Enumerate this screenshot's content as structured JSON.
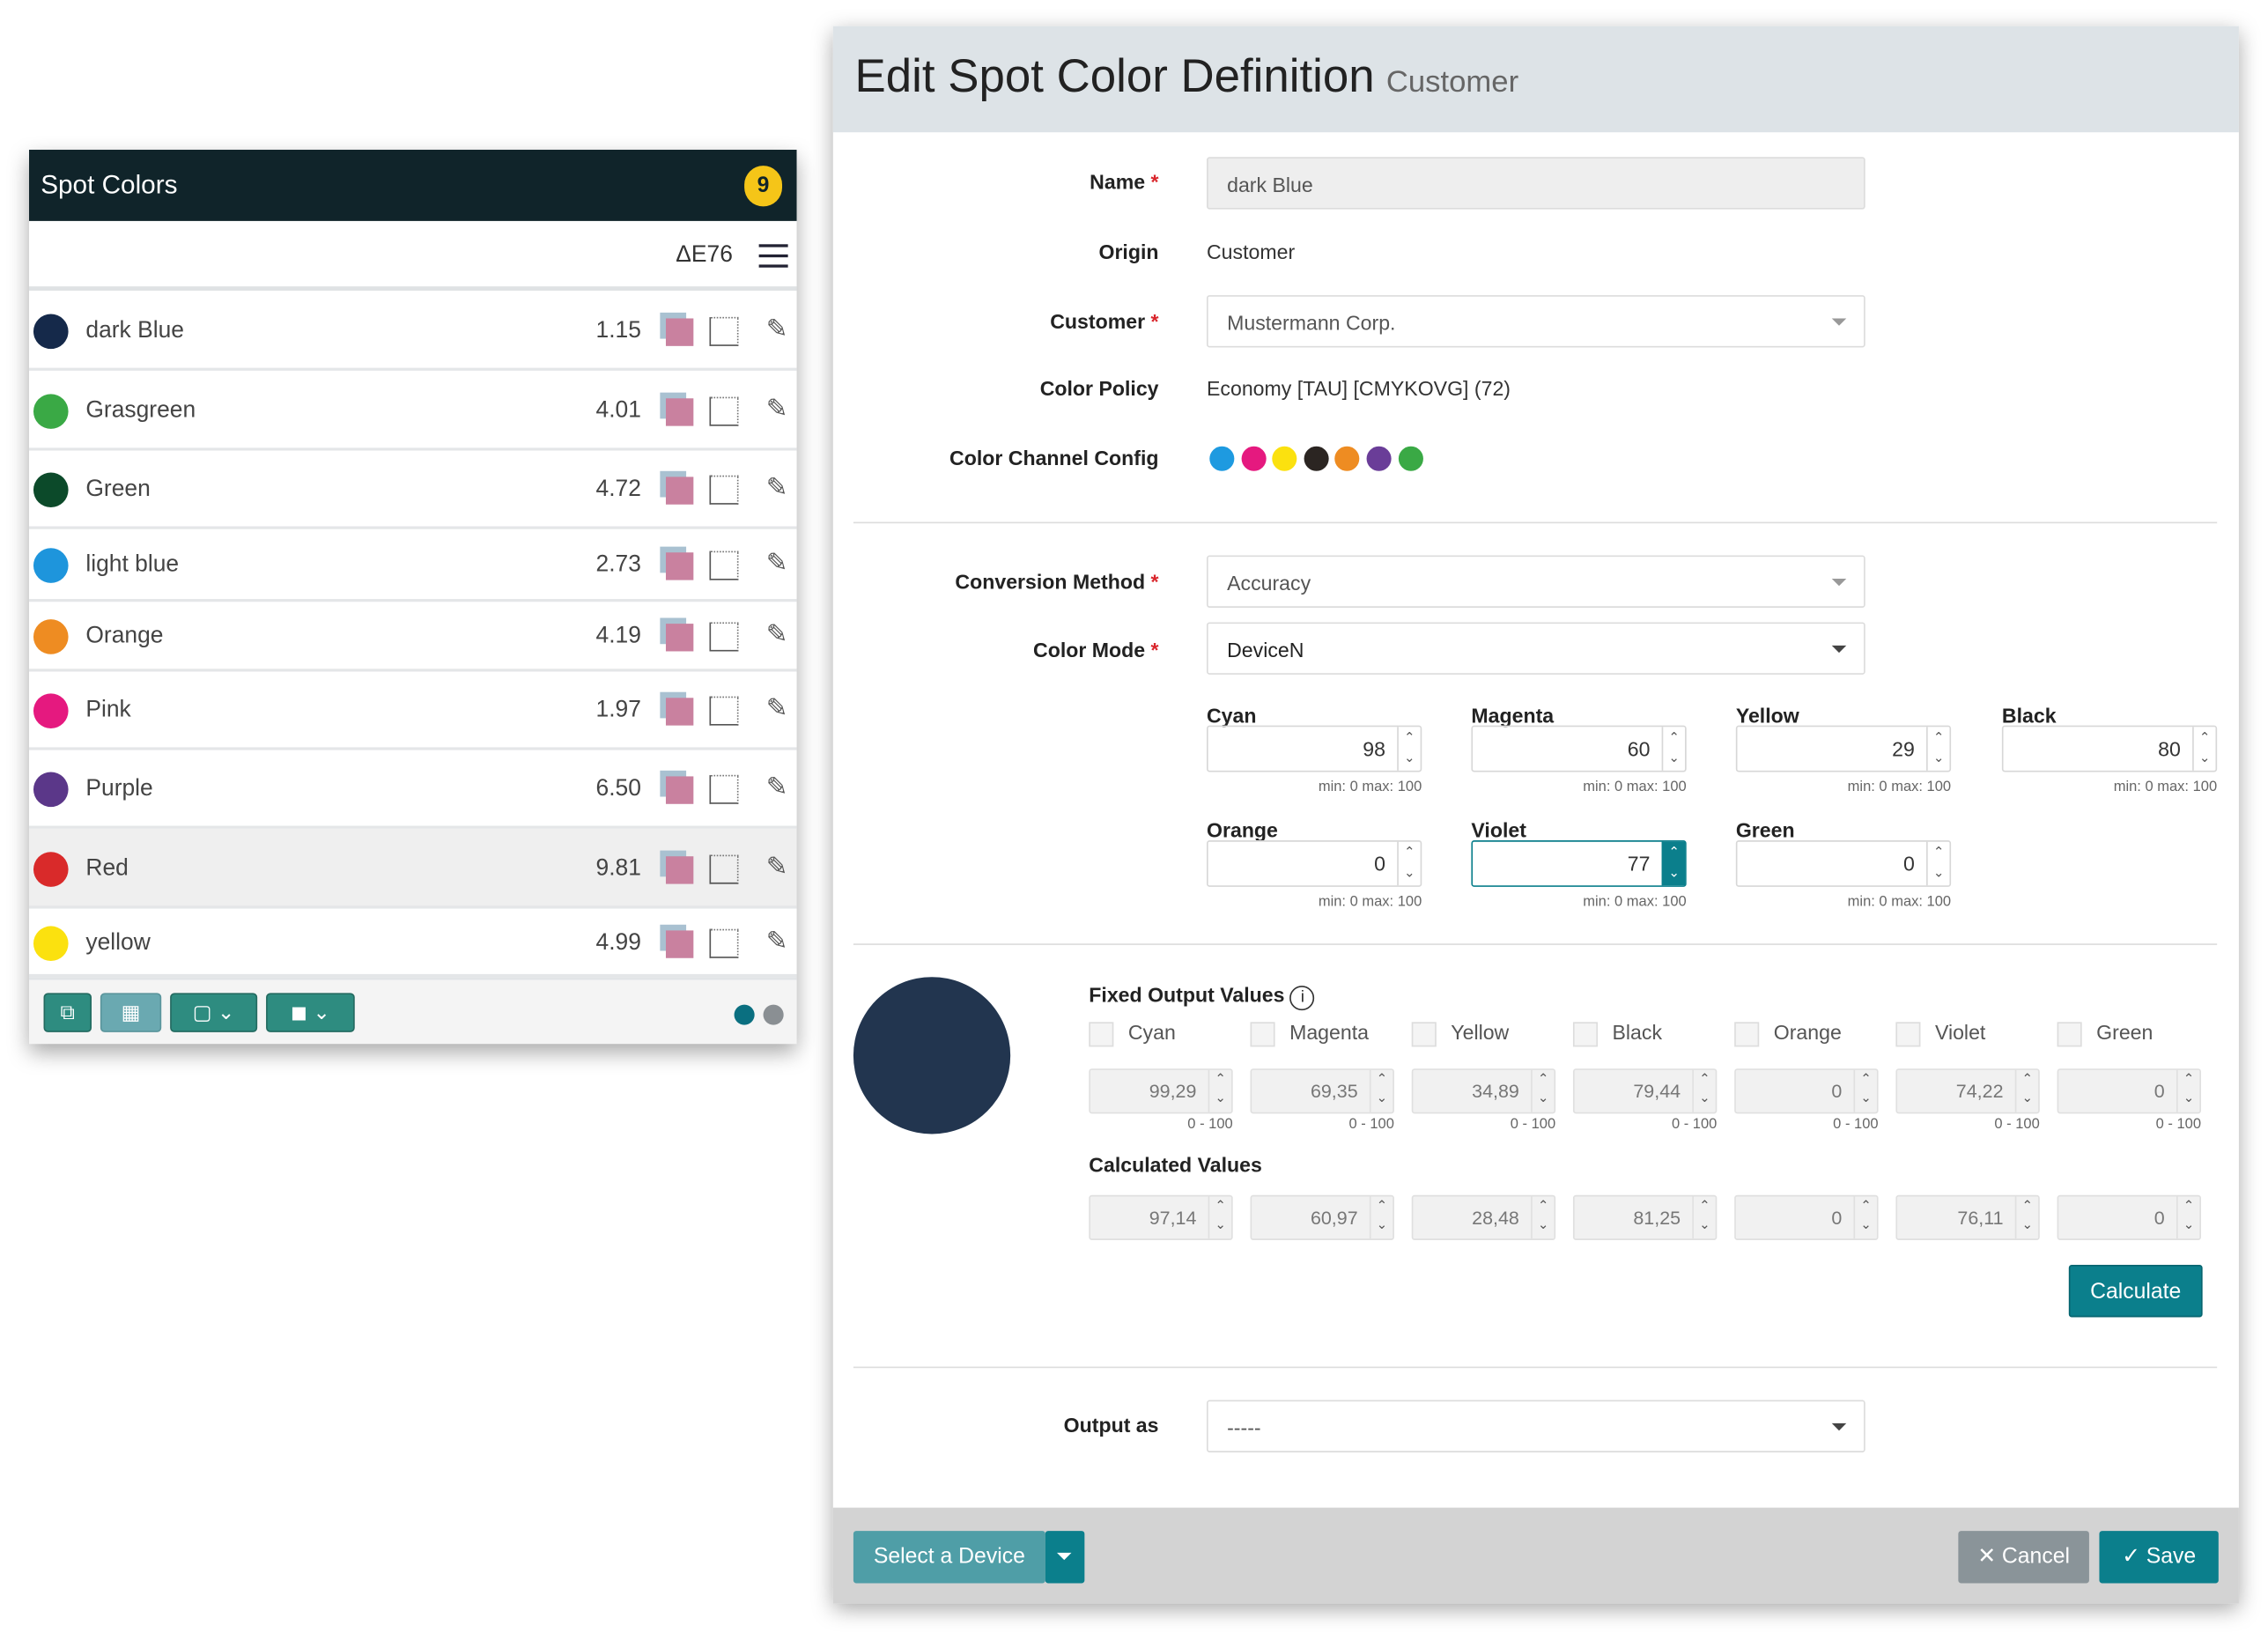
{
  "spot_panel": {
    "title": "Spot Colors",
    "count": "9",
    "metric": "ΔE76",
    "items": [
      {
        "name": "dark Blue",
        "value": "1.15",
        "color": "#15294a"
      },
      {
        "name": "Grasgreen",
        "value": "4.01",
        "color": "#3aa945"
      },
      {
        "name": "Green",
        "value": "4.72",
        "color": "#0c4a2a"
      },
      {
        "name": "light blue",
        "value": "2.73",
        "color": "#1e95dc"
      },
      {
        "name": "Orange",
        "value": "4.19",
        "color": "#ee8c22"
      },
      {
        "name": "Pink",
        "value": "1.97",
        "color": "#e5197f"
      },
      {
        "name": "Purple",
        "value": "6.50",
        "color": "#5b3789"
      },
      {
        "name": "Red",
        "value": "9.81",
        "color": "#d92a2a",
        "selected": true
      },
      {
        "name": "yellow",
        "value": "4.99",
        "color": "#fbe10f"
      }
    ],
    "footer_icons": [
      "edit-color-icon",
      "grid-icon",
      "frame-dropdown-icon",
      "shape-dropdown-icon"
    ],
    "pagination_colors": [
      "#0a6f80",
      "#8a8f93"
    ]
  },
  "dialog": {
    "title": "Edit Spot Color Definition",
    "subtitle": "Customer",
    "name_label": "Name",
    "name_value": "dark Blue",
    "origin_label": "Origin",
    "origin_value": "Customer",
    "customer_label": "Customer",
    "customer_value": "Mustermann Corp.",
    "policy_label": "Color Policy",
    "policy_value": "Economy [TAU] [CMYKOVG] (72)",
    "channel_config_label": "Color Channel Config",
    "channel_colors": [
      "#1e9ae0",
      "#e5197f",
      "#fbe10f",
      "#2b2522",
      "#ee8c22",
      "#6a3d98",
      "#3aa945"
    ],
    "conversion_label": "Conversion Method",
    "conversion_value": "Accuracy",
    "mode_label": "Color Mode",
    "mode_value": "DeviceN",
    "channels": [
      {
        "label": "Cyan",
        "value": "98",
        "range": "min: 0  max: 100"
      },
      {
        "label": "Magenta",
        "value": "60",
        "range": "min: 0  max: 100"
      },
      {
        "label": "Yellow",
        "value": "29",
        "range": "min: 0  max: 100"
      },
      {
        "label": "Black",
        "value": "80",
        "range": "min: 0  max: 100"
      },
      {
        "label": "Orange",
        "value": "0",
        "range": "min: 0  max: 100"
      },
      {
        "label": "Violet",
        "value": "77",
        "range": "min: 0  max: 100",
        "active": true
      },
      {
        "label": "Green",
        "value": "0",
        "range": "min: 0  max: 100"
      }
    ],
    "preview_color": "#22354f",
    "fixed_title": "Fixed Output Values",
    "fixed": [
      {
        "label": "Cyan",
        "value": "99,29",
        "range": "0 - 100"
      },
      {
        "label": "Magenta",
        "value": "69,35",
        "range": "0 - 100"
      },
      {
        "label": "Yellow",
        "value": "34,89",
        "range": "0 - 100"
      },
      {
        "label": "Black",
        "value": "79,44",
        "range": "0 - 100"
      },
      {
        "label": "Orange",
        "value": "0",
        "range": "0 - 100"
      },
      {
        "label": "Violet",
        "value": "74,22",
        "range": "0 - 100"
      },
      {
        "label": "Green",
        "value": "0",
        "range": "0 - 100"
      }
    ],
    "calc_title": "Calculated Values",
    "calculated": [
      "97,14",
      "60,97",
      "28,48",
      "81,25",
      "0",
      "76,11",
      "0"
    ],
    "calculate_label": "Calculate",
    "output_label": "Output as",
    "output_value": "-----",
    "select_device_label": "Select a Device",
    "cancel_label": "Cancel",
    "save_label": "Save",
    "accent": "#0b7f8c"
  }
}
